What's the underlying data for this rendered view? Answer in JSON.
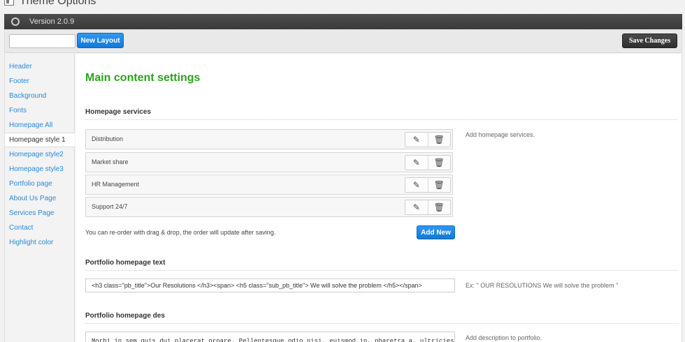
{
  "page_title": "Theme Options",
  "topbar": {
    "version": "Version 2.0.9"
  },
  "toolbar": {
    "search_placeholder": "",
    "new_layout_label": "New Layout",
    "save_label": "Save Changes"
  },
  "sidebar": {
    "items": [
      {
        "label": "Header",
        "active": false
      },
      {
        "label": "Footer",
        "active": false
      },
      {
        "label": "Background",
        "active": false
      },
      {
        "label": "Fonts",
        "active": false
      },
      {
        "label": "Homepage All",
        "active": false
      },
      {
        "label": "Homepage style 1",
        "active": true
      },
      {
        "label": "Homepage style2",
        "active": false
      },
      {
        "label": "Homepage style3",
        "active": false
      },
      {
        "label": "Portfolio page",
        "active": false
      },
      {
        "label": "About Us Page",
        "active": false
      },
      {
        "label": "Services Page",
        "active": false
      },
      {
        "label": "Contact",
        "active": false
      },
      {
        "label": "Highlight color",
        "active": false
      }
    ]
  },
  "main": {
    "title": "Main content settings",
    "services": {
      "title": "Homepage services",
      "items": [
        "Distribution",
        "Market share",
        "HR Management",
        "Support 24/7"
      ],
      "help": "Add homepage services.",
      "note": "You can re-order with drag & drop, the order will update after saving.",
      "add_new_label": "Add New",
      "edit_icon": "pencil-icon",
      "delete_icon": "trash-icon"
    },
    "portfolio_text": {
      "title": "Portfolio homepage text",
      "value": "<h3 class=\"pb_title\">Our Resolutions </h3><span> <h5 class=\"sub_pb_title\"> We will solve the problem </h5></span>",
      "help": "Ex: \" OUR RESOLUTIONS We will solve the problem \""
    },
    "portfolio_des": {
      "title": "Portfolio homepage des",
      "value": "Morbi in sem quis dui placerat ornare. Pellentesque odio nisi, euismod in, pharetra a, ultricies",
      "help": "Add description to portfolio."
    }
  },
  "colors": {
    "accent_blue": "#1e8cf2",
    "title_green": "#2aa31a",
    "topbar_dark": "#464646"
  }
}
